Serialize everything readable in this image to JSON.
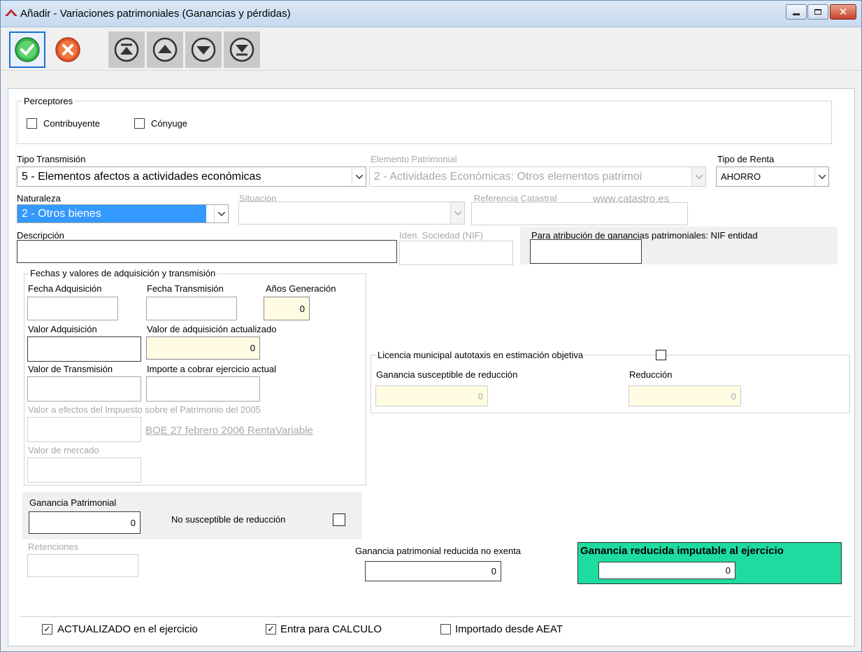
{
  "window": {
    "title": "Añadir  - Variaciones patrimoniales (Ganancias y pérdidas)"
  },
  "toolbar": {
    "accept_icon": "check-icon",
    "cancel_icon": "cancel-x-icon",
    "nav_icons": [
      "first-record-icon",
      "previous-record-icon",
      "next-record-icon",
      "last-record-icon"
    ]
  },
  "perceptores": {
    "title": "Perceptores",
    "contribuyente_label": "Contribuyente",
    "conyuge_label": "Cónyuge"
  },
  "tipo_transmision": {
    "label": "Tipo Transmisión",
    "value": "5 - Elementos afectos a actividades económicas"
  },
  "elemento_patrimonial": {
    "label": "Elemento Patrimonial",
    "value": "2 - Actividades Económicas: Otros elementos patrimoi"
  },
  "tipo_renta": {
    "label": "Tipo de Renta",
    "value": "AHORRO"
  },
  "naturaleza": {
    "label": "Naturaleza",
    "value": "2 - Otros bienes"
  },
  "situacion": {
    "label": "Situación",
    "value": ""
  },
  "referencia_catastral": {
    "label": "Referencia Catastral",
    "link": "www.catastro.es",
    "value": ""
  },
  "descripcion": {
    "label": "Descripción",
    "value": ""
  },
  "iden_sociedad": {
    "label": "Iden. Sociedad (NIF)",
    "value": ""
  },
  "atribucion": {
    "label": "Para atribución de ganancias patrimoniales: NIF entidad",
    "value": ""
  },
  "fechas": {
    "title": "Fechas y valores de adquisición y transmisión",
    "fecha_adquisicion_label": "Fecha Adquisición",
    "fecha_transmision_label": "Fecha Transmisión",
    "anos_generacion_label": "Años Generación",
    "anos_generacion_value": "0",
    "valor_adquisicion_label": "Valor Adquisición",
    "valor_adq_actualizado_label": "Valor de adquisición actualizado",
    "valor_adq_actualizado_value": "0",
    "valor_transmision_label": "Valor de Transmisión",
    "importe_cobrar_label": "Importe a cobrar ejercicio actual",
    "valor_patrimonio_label": "Valor a efectos del Impuesto sobre el Patrimonio del 2005",
    "boe_link": "BOE 27 febrero 2006 RentaVariable",
    "valor_mercado_label": "Valor de mercado"
  },
  "licencia": {
    "title": "Licencia municipal autotaxis en estimación objetiva",
    "ganancia_susceptible_label": "Ganancia susceptible de reducción",
    "ganancia_susceptible_value": "0",
    "reduccion_label": "Reducción",
    "reduccion_value": "0"
  },
  "ganancia_patrimonial": {
    "label": "Ganancia Patrimonial",
    "value": "0",
    "no_susceptible_label": "No susceptible de reducción"
  },
  "retenciones": {
    "label": "Retenciones",
    "value": ""
  },
  "reducida_no_exenta": {
    "label": "Ganancia patrimonial reducida no exenta",
    "value": "0"
  },
  "reducida_imputable": {
    "label": "Ganancia reducida imputable al ejercicio",
    "value": "0",
    "color": "#1edc9f"
  },
  "footer": {
    "actualizado_label": "ACTUALIZADO en el ejercicio",
    "actualizado_checked": true,
    "calculo_label": "Entra para CALCULO",
    "calculo_checked": true,
    "importado_label": "Importado desde AEAT",
    "importado_checked": false
  }
}
